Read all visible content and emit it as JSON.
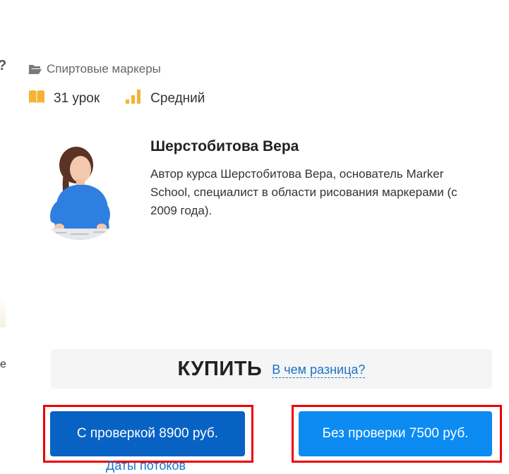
{
  "edge": {
    "left_char_top": "?",
    "left_char_bottom": "e"
  },
  "course": {
    "category": "Спиртовые маркеры",
    "lessons": "31 урок",
    "level": "Средний"
  },
  "author": {
    "name": "Шерстобитова Вера",
    "bio": "Автор курса Шерстобитова Вера, основатель Marker School, специалист в области рисования маркерами (с 2009 года)."
  },
  "buy": {
    "title": "КУПИТЬ",
    "difference_link": "В чем разница?"
  },
  "buttons": {
    "with_review": "С проверкой 8900 руб.",
    "without_review": "Без проверки 7500 руб."
  },
  "dates_link": "Даты потоков",
  "colors": {
    "primary_dark": "#0762c4",
    "primary_light": "#0c8bf2",
    "highlight_frame": "#ee0000",
    "accent_icon": "#f5b335"
  },
  "icons": {
    "category": "folder-open-icon",
    "lessons": "book-icon",
    "level": "signal-bars-icon"
  }
}
